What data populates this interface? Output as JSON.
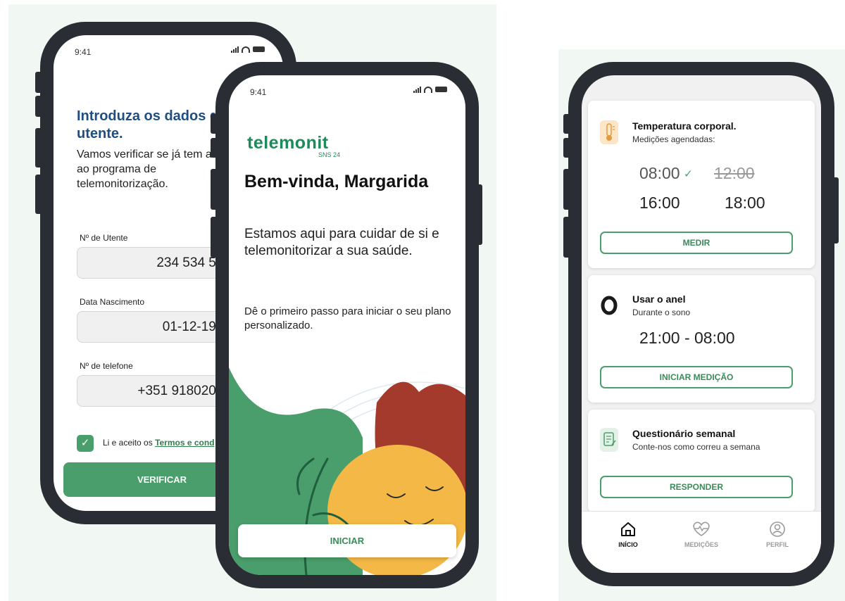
{
  "status_time": "9:41",
  "colors": {
    "brand_green": "#4a9e6b",
    "brand_blue": "#1f4e82",
    "logo_green": "#1d8a5b",
    "phone_frame": "#2a2d33"
  },
  "verify_screen": {
    "title": "Introduza os dados de utente.",
    "subtitle": "Vamos verificar se já tem acesso ao programa de telemonitorização.",
    "fields": [
      {
        "label": "Nº de Utente",
        "value": "234 534 534"
      },
      {
        "label": "Data Nascimento",
        "value": "01-12-1965"
      },
      {
        "label": "Nº de telefone",
        "value": "+351 91802000"
      }
    ],
    "terms_prefix": "Li e aceito os",
    "terms_link": "Termos e cond",
    "terms_checked": true,
    "verify_button": "VERIFICAR"
  },
  "welcome_screen": {
    "logo": "telemonit",
    "logo_sub": "SNS 24",
    "title": "Bem-vinda, Margarida",
    "subtitle": "Estamos aqui para cuidar de si e telemonitorizar a sua saúde.",
    "body": "Dê o primeiro passo para iniciar o seu plano personalizado.",
    "start_button": "INICIAR"
  },
  "home_screen": {
    "cards": [
      {
        "icon": "thermometer-icon",
        "title": "Temperatura corporal.",
        "subtitle": "Medições agendadas:",
        "times": [
          {
            "time": "08:00",
            "status": "done"
          },
          {
            "time": "12:00",
            "status": "missed"
          },
          {
            "time": "16:00",
            "status": "pending"
          },
          {
            "time": "18:00",
            "status": "pending"
          }
        ],
        "button": "MEDIR"
      },
      {
        "icon": "ring-icon",
        "title": "Usar o anel",
        "subtitle": "Durante o sono",
        "range": "21:00 - 08:00",
        "button": "INICIAR MEDIÇÃO"
      },
      {
        "icon": "questionnaire-icon",
        "title": "Questionário semanal",
        "subtitle": "Conte-nos como correu a semana",
        "button": "RESPONDER"
      }
    ],
    "tabs": [
      {
        "icon": "home-icon",
        "label": "INÍCIO",
        "active": true
      },
      {
        "icon": "heartbeat-icon",
        "label": "MEDIÇÕES",
        "active": false
      },
      {
        "icon": "profile-icon",
        "label": "PERFIL",
        "active": false
      }
    ]
  }
}
